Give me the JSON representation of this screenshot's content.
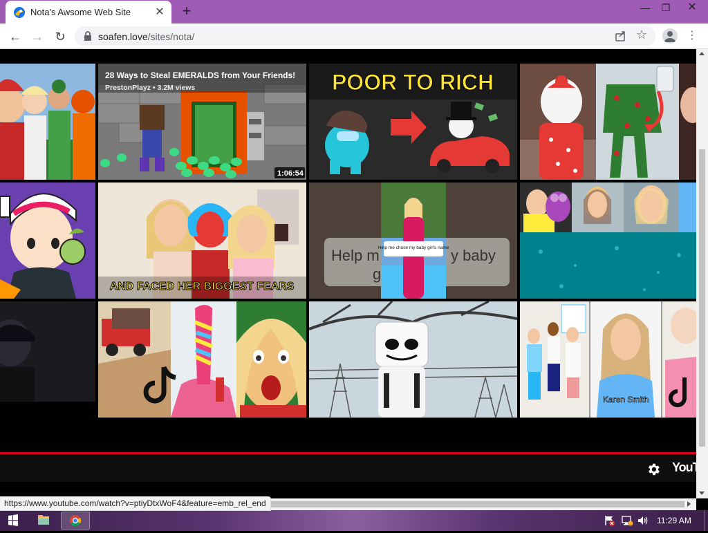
{
  "tab": {
    "title": "Nota's Awsome Web Site",
    "close": "✕",
    "new_tab": "+"
  },
  "window_controls": {
    "minimize": "—",
    "restore": "❐",
    "close": "✕"
  },
  "nav": {
    "back": "←",
    "forward": "→",
    "reload": "↻"
  },
  "omnibox": {
    "host": "soafen.love",
    "path": "/sites/nota/"
  },
  "menu": "⋮",
  "videos": {
    "v2": {
      "title": "28 Ways to Steal EMERALDS from Your Friends!",
      "meta": "PrestonPlayz • 3.2M views",
      "duration": "1:06:54"
    },
    "v3": {
      "headline": "POOR TO RICH"
    },
    "v6": {
      "caption": "AND FACED HER BIGGEST FEARS"
    },
    "v7": {
      "overlay": "Help me chose my baby girl's name",
      "bg_text_left": "Help m",
      "bg_text_right": "y baby",
      "bg_text_low": "g"
    },
    "v12": {
      "caption": "Karen Smith"
    }
  },
  "player": {
    "logo": "YouTu"
  },
  "status_url": "https://www.youtube.com/watch?v=ptiyDtxWoF4&feature=emb_rel_end",
  "taskbar": {
    "clock": "11:29 AM"
  },
  "colors": {
    "titlebar": "#a05bb7",
    "progress": "#e0001a"
  }
}
